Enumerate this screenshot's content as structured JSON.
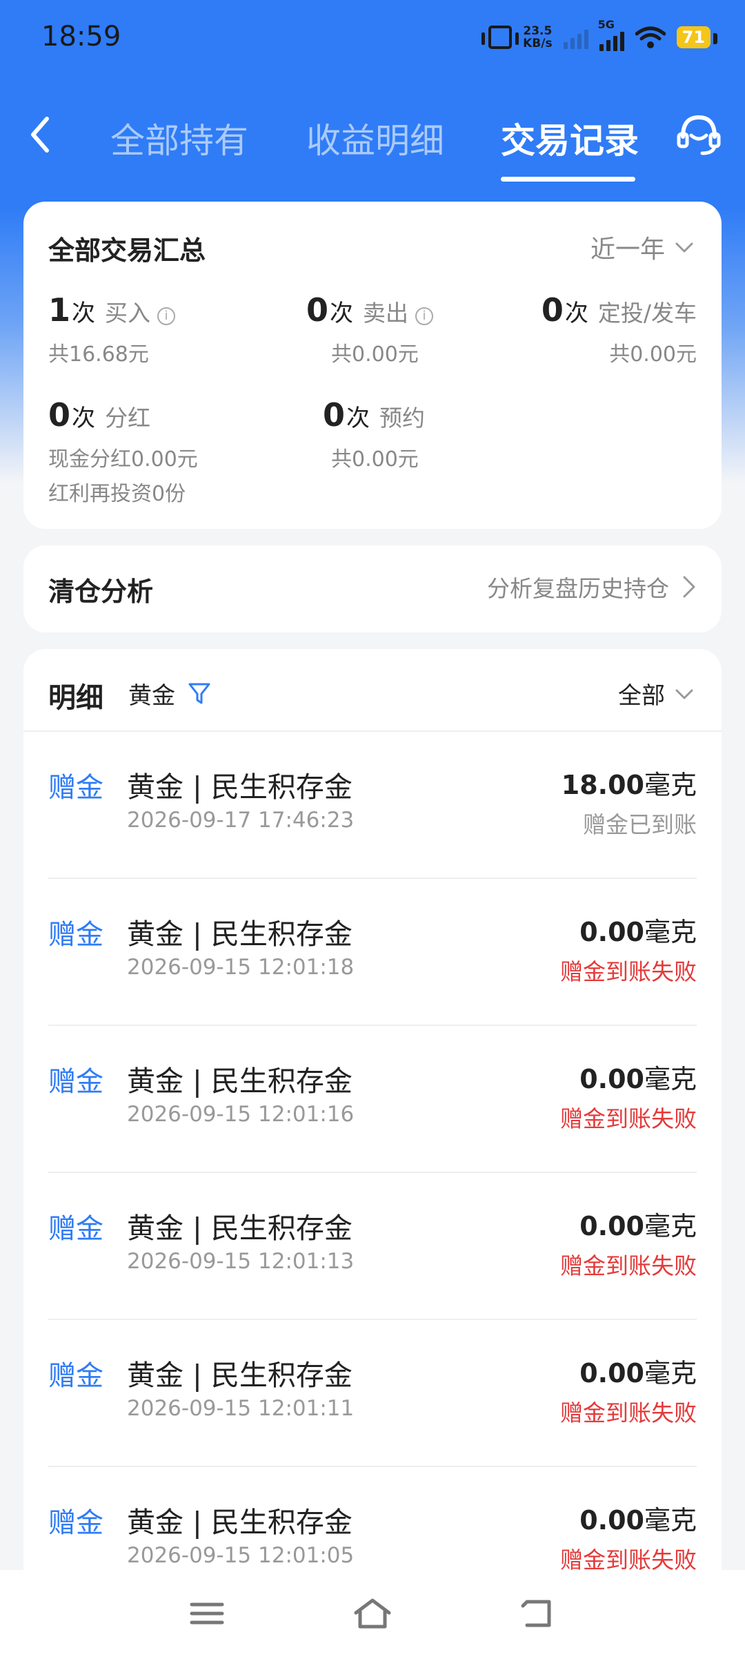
{
  "status_bar": {
    "time": "18:59",
    "net_speed_value": "23.5",
    "net_speed_unit": "KB/s",
    "network_label": "5G",
    "battery": "71"
  },
  "nav": {
    "tabs": [
      {
        "label": "全部持有",
        "active": false
      },
      {
        "label": "收益明细",
        "active": false
      },
      {
        "label": "交易记录",
        "active": true
      }
    ]
  },
  "summary": {
    "title": "全部交易汇总",
    "range": "近一年",
    "stats": [
      {
        "count": "1",
        "unit": "次",
        "label": "买入",
        "sub": "共16.68元"
      },
      {
        "count": "0",
        "unit": "次",
        "label": "卖出",
        "sub": "共0.00元"
      },
      {
        "count": "0",
        "unit": "次",
        "label": "定投/发车",
        "sub": "共0.00元"
      },
      {
        "count": "0",
        "unit": "次",
        "label": "分红",
        "sub": "现金分红0.00元",
        "sub2": "红利再投资0份"
      },
      {
        "count": "0",
        "unit": "次",
        "label": "预约",
        "sub": "共0.00元"
      }
    ]
  },
  "clearance": {
    "title": "清仓分析",
    "link": "分析复盘历史持仓"
  },
  "details": {
    "title": "明细",
    "filter": "黄金",
    "scope": "全部",
    "rows": [
      {
        "type": "赠金",
        "name": "黄金 | 民生积存金",
        "date": "2026-09-17 17:46:23",
        "amount": "18.00",
        "unit": "毫克",
        "status": "赠金已到账",
        "failed": false
      },
      {
        "type": "赠金",
        "name": "黄金 | 民生积存金",
        "date": "2026-09-15 12:01:18",
        "amount": "0.00",
        "unit": "毫克",
        "status": "赠金到账失败",
        "failed": true
      },
      {
        "type": "赠金",
        "name": "黄金 | 民生积存金",
        "date": "2026-09-15 12:01:16",
        "amount": "0.00",
        "unit": "毫克",
        "status": "赠金到账失败",
        "failed": true
      },
      {
        "type": "赠金",
        "name": "黄金 | 民生积存金",
        "date": "2026-09-15 12:01:13",
        "amount": "0.00",
        "unit": "毫克",
        "status": "赠金到账失败",
        "failed": true
      },
      {
        "type": "赠金",
        "name": "黄金 | 民生积存金",
        "date": "2026-09-15 12:01:11",
        "amount": "0.00",
        "unit": "毫克",
        "status": "赠金到账失败",
        "failed": true
      },
      {
        "type": "赠金",
        "name": "黄金 | 民生积存金",
        "date": "2026-09-15 12:01:05",
        "amount": "0.00",
        "unit": "毫克",
        "status": "赠金到账失败",
        "failed": true
      }
    ]
  },
  "colors": {
    "accent": "#2f7cf6",
    "fail": "#e53a3a"
  }
}
